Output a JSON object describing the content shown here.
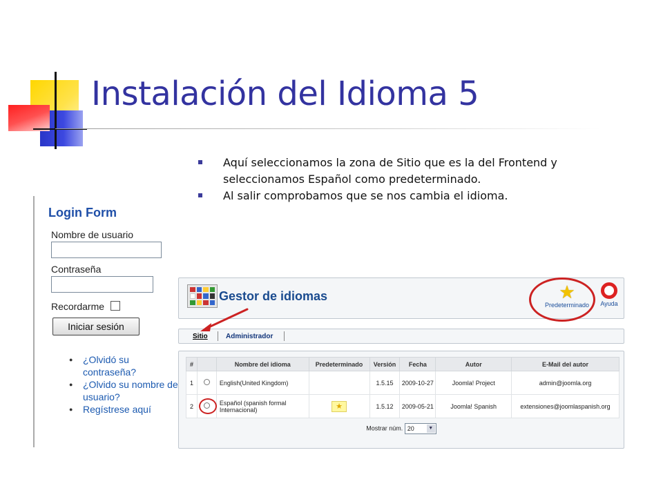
{
  "slide": {
    "title": "Instalación del Idioma 5",
    "bullets": [
      "Aquí seleccionamos la zona de Sitio que es la del Frontend y seleccionamos Español como predeterminado.",
      "Al salir comprobamos que se nos cambia el idioma."
    ]
  },
  "login": {
    "title": "Login Form",
    "username_label": "Nombre de usuario",
    "password_label": "Contraseña",
    "remember_label": "Recordarme",
    "submit_label": "Iniciar sesión",
    "links": [
      "¿Olvidó su contraseña?",
      "¿Olvido su nombre de usuario?",
      "Regístrese aquí"
    ]
  },
  "manager": {
    "title": "Gestor de idiomas",
    "default_label": "Predeterminado",
    "help_label": "Ayuda",
    "tabs": [
      "Sitio",
      "Administrador"
    ],
    "columns": [
      "#",
      "",
      "Nombre del idioma",
      "Predeterminado",
      "Versión",
      "Fecha",
      "Autor",
      "E-Mail del autor"
    ],
    "rows": [
      {
        "num": "1",
        "name": "English(United Kingdom)",
        "version": "1.5.15",
        "date": "2009-10-27",
        "author": "Joomla! Project",
        "email": "admin@joomla.org"
      },
      {
        "num": "2",
        "name": "Español (spanish formal Internacional)",
        "version": "1.5.12",
        "date": "2009-05-21",
        "author": "Joomla! Spanish",
        "email": "extensiones@joomlaspanish.org"
      }
    ],
    "show_label": "Mostrar núm.",
    "show_value": "20"
  },
  "colors": {
    "title": "#3333a0",
    "highlight": "#cc2222",
    "link": "#1c5ab0"
  }
}
